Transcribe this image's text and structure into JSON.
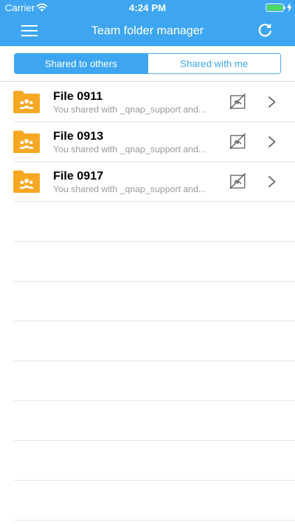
{
  "status_bar": {
    "carrier": "Carrier",
    "time": "4:24 PM",
    "battery_icon": "battery-charging-icon",
    "wifi_icon": "wifi-icon"
  },
  "nav_bar": {
    "title": "Team folder manager",
    "menu_icon": "hamburger-menu-icon",
    "refresh_icon": "refresh-icon"
  },
  "tabs": [
    {
      "label": "Shared to others",
      "active": true
    },
    {
      "label": "Shared with me",
      "active": false
    }
  ],
  "folders": [
    {
      "name": "File 0911",
      "subtitle": "You shared with _qnap_support and..."
    },
    {
      "name": "File 0913",
      "subtitle": "You shared with _qnap_support and..."
    },
    {
      "name": "File 0917",
      "subtitle": "You shared with _qnap_support and..."
    }
  ],
  "colors": {
    "accent": "#3ea6f0",
    "folder": "#f7a823",
    "battery": "#4cd964"
  }
}
